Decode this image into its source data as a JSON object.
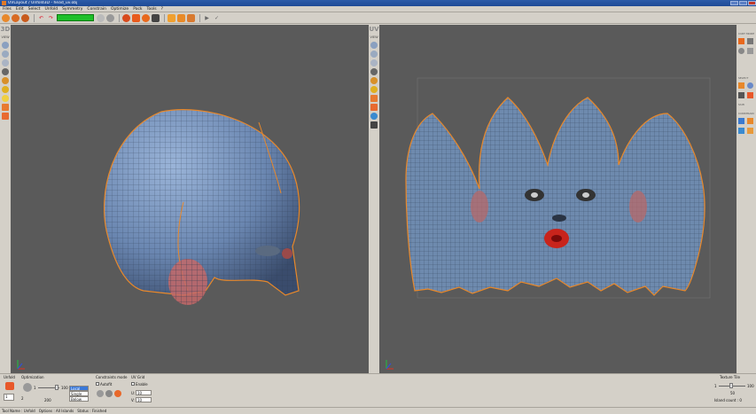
{
  "window": {
    "title": "UVLayout / Unfold3D - head_uv.obj"
  },
  "menu": {
    "items": [
      "Files",
      "Edit",
      "Select",
      "Unfold",
      "Symmetry",
      "Constrain",
      "Optimize",
      "Pack",
      "Tools",
      "?"
    ]
  },
  "viewport3d": {
    "label": "3D",
    "sublabel": "VIEW"
  },
  "viewportuv": {
    "label": "UV",
    "sublabel": "VIEW"
  },
  "rightpanel": {
    "sections": [
      "CURT MODE",
      "SELECT",
      "CONSTRAIN"
    ],
    "select_label": "Shift"
  },
  "bottom": {
    "unfold": {
      "title": "Unfold",
      "count": "1"
    },
    "optimization": {
      "title": "Optimization",
      "value": "100",
      "min": "1",
      "max": "200",
      "iterations": "2",
      "modes": [
        "Local",
        "Single",
        "Below"
      ],
      "selected_mode": "Local"
    },
    "constraints": {
      "title": "Constraints mode",
      "checkbox": "Autofit"
    },
    "uvgrid": {
      "title": "UV Grid",
      "checkbox": "Enable",
      "u_label": "U:",
      "u_value": "10",
      "v_label": "V:",
      "v_value": "10"
    },
    "texture": {
      "title": "Texture Tile",
      "min": "1",
      "max": "100",
      "value": "50",
      "island_count": "Island count : 0"
    }
  },
  "status": {
    "tool": "Tool Name : Unfold",
    "options": "Options : All Islands",
    "state": "Status : Finished"
  },
  "colors": {
    "viewport_bg": "#5a5a5a",
    "mesh_fill": "#6e8aae",
    "seam": "#e8882a",
    "progress": "#1fbf2a",
    "lips": "#c8241c"
  }
}
